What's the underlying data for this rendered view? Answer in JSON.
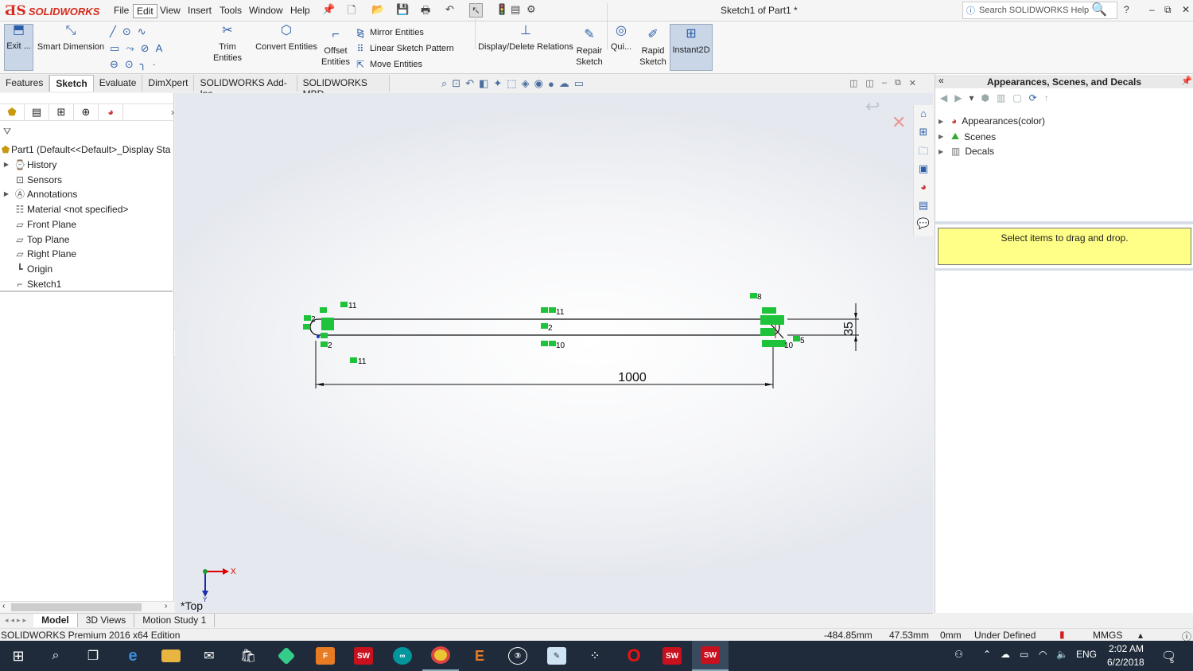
{
  "app": {
    "brand": "SOLIDWORKS",
    "menus": [
      "File",
      "Edit",
      "View",
      "Insert",
      "Tools",
      "Window",
      "Help"
    ],
    "doc_title": "Sketch1 of Part1 *",
    "search_placeholder": "Search SOLIDWORKS Help"
  },
  "ribbon": {
    "exit": "Exit ...",
    "smart_dimension": "Smart Dimension",
    "trim": "Trim Entities",
    "convert": "Convert Entities",
    "offset1": "Offset",
    "offset2": "Entities",
    "mirror": "Mirror Entities",
    "linear_pattern": "Linear Sketch Pattern",
    "move": "Move Entities",
    "display_delete": "Display/Delete Relations",
    "repair1": "Repair",
    "repair2": "Sketch",
    "quick": "Qui...",
    "rapid1": "Rapid",
    "rapid2": "Sketch",
    "instant2d": "Instant2D"
  },
  "tabs": [
    "Features",
    "Sketch",
    "Evaluate",
    "DimXpert",
    "SOLIDWORKS Add-Ins",
    "SOLIDWORKS MBD"
  ],
  "tree": {
    "root": "Part1  (Default<<Default>_Display Sta",
    "items": [
      "History",
      "Sensors",
      "Annotations",
      "Material <not specified>",
      "Front Plane",
      "Top Plane",
      "Right Plane",
      "Origin",
      "Sketch1"
    ]
  },
  "viewport": {
    "view_label": "*Top",
    "dim_length": "1000",
    "dim_width": "35",
    "triad_x": "X",
    "triad_y": "Y"
  },
  "right_panel": {
    "title": "Appearances, Scenes, and Decals",
    "items": [
      "Appearances(color)",
      "Scenes",
      "Decals"
    ],
    "drop_text": "Select items to drag and drop."
  },
  "bottom_tabs": [
    "Model",
    "3D Views",
    "Motion Study 1"
  ],
  "status": {
    "edition": "SOLIDWORKS Premium 2016 x64 Edition",
    "x": "-484.85mm",
    "y": "47.53mm",
    "z": "0mm",
    "state": "Under Defined",
    "units": "MMGS"
  },
  "taskbar": {
    "lang": "ENG",
    "time": "2:02 AM",
    "date": "6/2/2018",
    "notif": "5"
  },
  "sketch_tags": [
    "11",
    "11",
    "2",
    "2",
    "10",
    "8",
    "5",
    "2",
    "2",
    "11",
    "10"
  ]
}
